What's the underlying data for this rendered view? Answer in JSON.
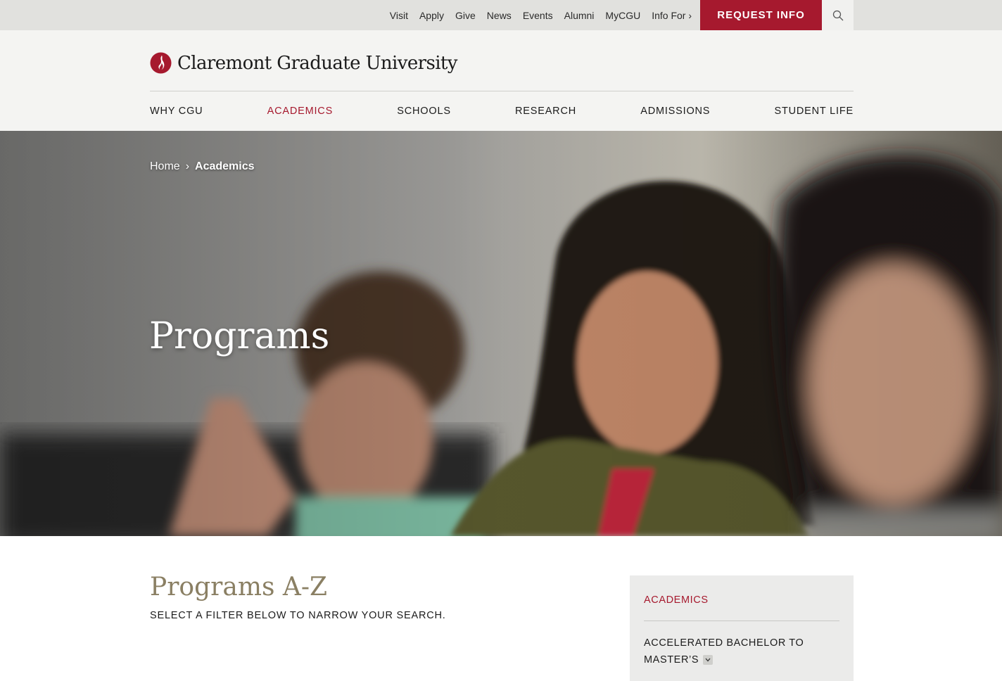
{
  "utility_nav": {
    "links": [
      "Visit",
      "Apply",
      "Give",
      "News",
      "Events",
      "Alumni",
      "MyCGU",
      "Info For ›"
    ],
    "request_label": "REQUEST INFO",
    "search_icon": "search-icon"
  },
  "header": {
    "logo_text": "Claremont Graduate University",
    "logo_icon": "flame-logo-icon"
  },
  "main_nav": {
    "items": [
      "WHY CGU",
      "ACADEMICS",
      "SCHOOLS",
      "RESEARCH",
      "ADMISSIONS",
      "STUDENT LIFE"
    ],
    "active": "ACADEMICS"
  },
  "hero": {
    "breadcrumb": {
      "home": "Home",
      "separator": "›",
      "current": "Academics"
    },
    "title": "Programs"
  },
  "content": {
    "title": "Programs A-Z",
    "subtitle": "SELECT A FILTER BELOW TO NARROW YOUR SEARCH."
  },
  "sidebar": {
    "heading": "ACADEMICS",
    "item_label": "ACCELERATED BACHELOR TO MASTER’S",
    "toggle_icon": "chevron-down-icon"
  },
  "colors": {
    "brand_red": "#a6192e",
    "title_gold": "#8a7f63"
  }
}
